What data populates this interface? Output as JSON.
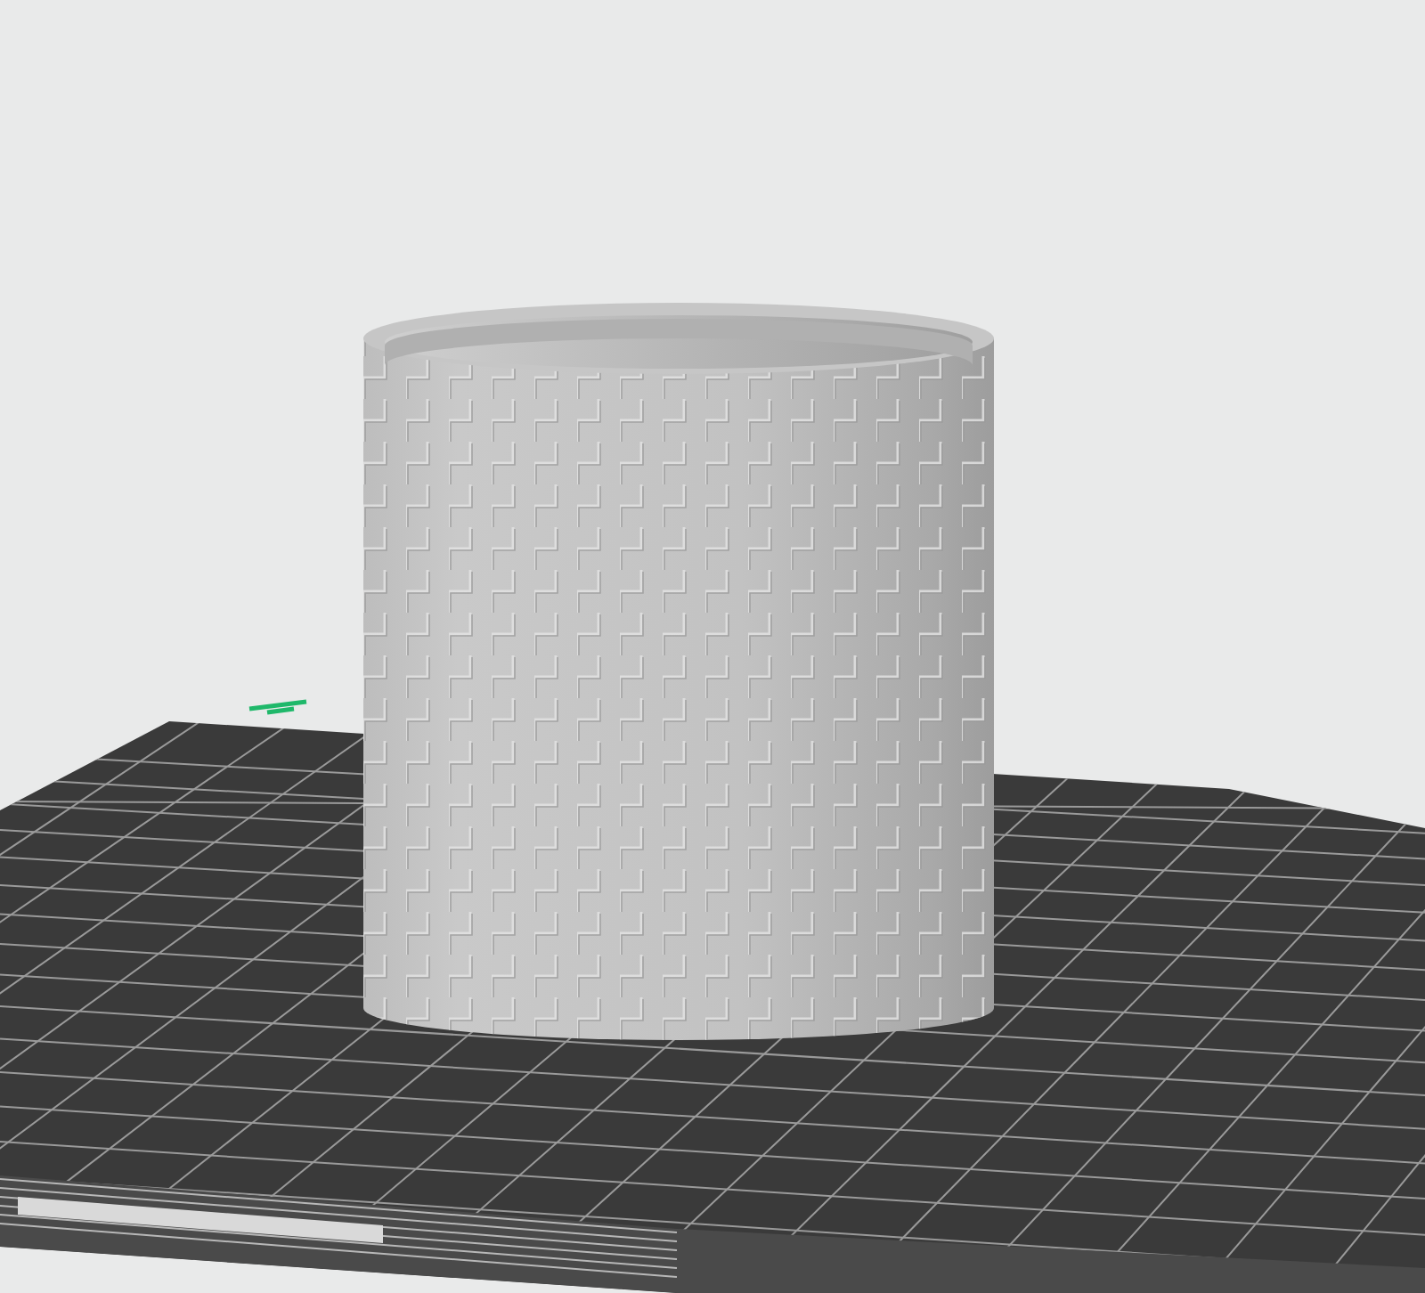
{
  "build_plate": {
    "grid": true
  },
  "model": {
    "kind": "cylinder"
  }
}
